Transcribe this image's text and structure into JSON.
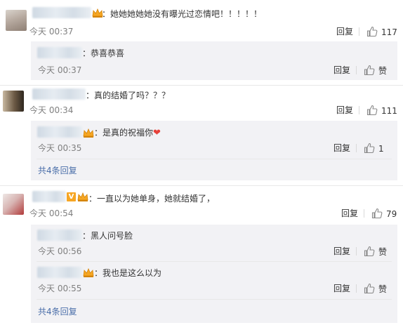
{
  "threads": [
    {
      "text": "：她她她她她没有曝光过恋情吧！！！！！",
      "time": "今天 00:37",
      "reply_label": "回复",
      "like_count": "117",
      "replies": [
        {
          "text": "：恭喜恭喜",
          "time": "今天 00:37",
          "reply_label": "回复",
          "like_label": "赞"
        }
      ]
    },
    {
      "text": "：真的结婚了吗？？？",
      "time": "今天 00:34",
      "reply_label": "回复",
      "like_count": "111",
      "replies": [
        {
          "text": "：是真的祝福你",
          "time": "今天 00:35",
          "reply_label": "回复",
          "like_count": "1"
        }
      ],
      "more": "共4条回复"
    },
    {
      "text": "：一直以为她单身，她就结婚了，",
      "time": "今天 00:54",
      "reply_label": "回复",
      "like_count": "79",
      "replies": [
        {
          "text": "：黑人问号脸",
          "time": "今天 00:56",
          "reply_label": "回复",
          "like_label": "赞"
        },
        {
          "text": "：我也是这么以为",
          "time": "今天 00:55",
          "reply_label": "回复",
          "like_label": "赞"
        }
      ],
      "more": "共4条回复"
    }
  ],
  "icons": {
    "thumb": "thumbs-up-icon",
    "crown": "crown-badge-icon",
    "verified": "verified-v-badge-icon",
    "heart": "heart-emoji-icon"
  },
  "colors": {
    "link": "#4a6ea9",
    "reply_bg": "#f2f2f5",
    "heart": "#e6413a",
    "badge": "#f6a623"
  },
  "verified_glyph": "V",
  "heart_glyph": "❤"
}
